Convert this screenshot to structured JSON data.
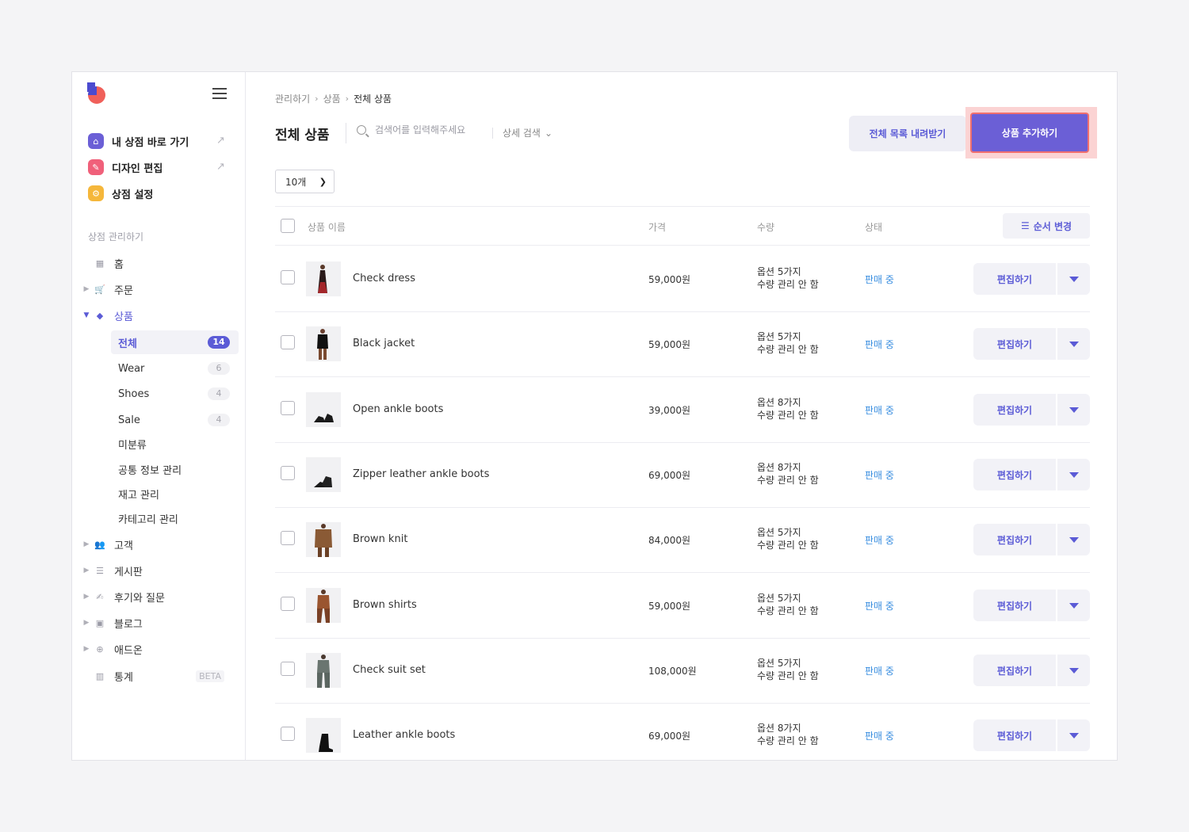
{
  "sidebar": {
    "quick_links": [
      {
        "label": "내 상점 바로 가기",
        "color": "#6b5fd6"
      },
      {
        "label": "디자인 편집",
        "color": "#f0607a"
      },
      {
        "label": "상점 설정",
        "color": "#f5b73b"
      }
    ],
    "section_title": "상점 관리하기",
    "nav": {
      "home": "홈",
      "orders": "주문",
      "products": "상품",
      "customers": "고객",
      "board": "게시판",
      "reviews": "후기와 질문",
      "blog": "블로그",
      "addons": "애드온",
      "stats": "통계",
      "stats_badge": "BETA"
    },
    "product_sub": [
      {
        "label": "전체",
        "count": "14"
      },
      {
        "label": "Wear",
        "count": "6"
      },
      {
        "label": "Shoes",
        "count": "4"
      },
      {
        "label": "Sale",
        "count": "4"
      },
      {
        "label": "미분류"
      },
      {
        "label": "공통 정보 관리"
      },
      {
        "label": "재고 관리"
      },
      {
        "label": "카테고리 관리"
      }
    ]
  },
  "breadcrumb": [
    "관리하기",
    "상품",
    "전체 상품"
  ],
  "header": {
    "title": "전체 상품",
    "search_placeholder": "검색어를 입력해주세요",
    "advanced_search": "상세 검색",
    "download_label": "전체 목록 내려받기",
    "add_label": "상품 추가하기"
  },
  "page_size": "10개",
  "table": {
    "columns": {
      "name": "상품 이름",
      "price": "가격",
      "qty": "수량",
      "status": "상태"
    },
    "order_button": "순서 변경",
    "edit_label": "편집하기",
    "rows": [
      {
        "name": "Check dress",
        "price": "59,000원",
        "qty1": "옵션 5가지",
        "qty2": "수량 관리 안 함",
        "status": "판매 중"
      },
      {
        "name": "Black jacket",
        "price": "59,000원",
        "qty1": "옵션 5가지",
        "qty2": "수량 관리 안 함",
        "status": "판매 중"
      },
      {
        "name": "Open ankle boots",
        "price": "39,000원",
        "qty1": "옵션 8가지",
        "qty2": "수량 관리 안 함",
        "status": "판매 중"
      },
      {
        "name": "Zipper leather ankle boots",
        "price": "69,000원",
        "qty1": "옵션 8가지",
        "qty2": "수량 관리 안 함",
        "status": "판매 중"
      },
      {
        "name": "Brown knit",
        "price": "84,000원",
        "qty1": "옵션 5가지",
        "qty2": "수량 관리 안 함",
        "status": "판매 중"
      },
      {
        "name": "Brown shirts",
        "price": "59,000원",
        "qty1": "옵션 5가지",
        "qty2": "수량 관리 안 함",
        "status": "판매 중"
      },
      {
        "name": "Check suit set",
        "price": "108,000원",
        "qty1": "옵션 5가지",
        "qty2": "수량 관리 안 함",
        "status": "판매 중"
      },
      {
        "name": "Leather ankle boots",
        "price": "69,000원",
        "qty1": "옵션 8가지",
        "qty2": "수량 관리 안 함",
        "status": "판매 중"
      }
    ]
  },
  "colors": {
    "accent": "#6b5fd6",
    "status_blue": "#3b8fe0",
    "highlight": "#fbd3d3"
  }
}
